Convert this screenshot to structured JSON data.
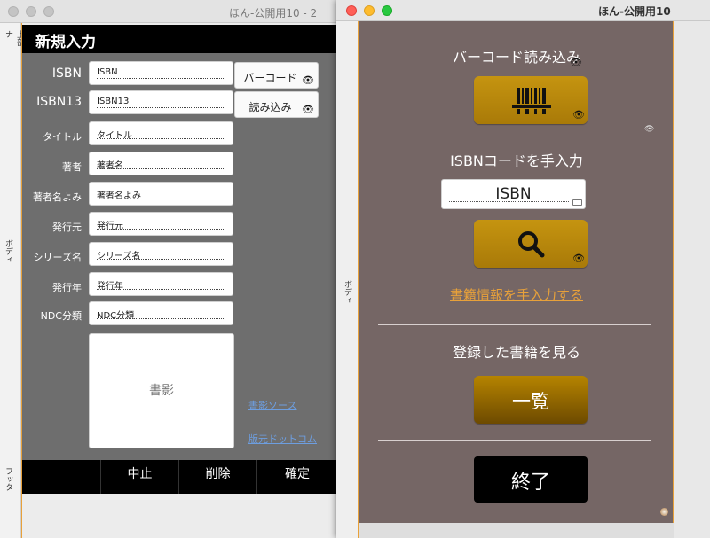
{
  "window_back": {
    "title": "ほん-公開用10 - 2",
    "parts": {
      "header": "上部ナ",
      "body": "ボディ",
      "footer": "フッタ"
    },
    "header_title": "新規入力",
    "fields": [
      {
        "label": "ISBN",
        "value": "ISBN"
      },
      {
        "label": "ISBN13",
        "value": "ISBN13"
      },
      {
        "label": "タイトル",
        "value": "タイトル"
      },
      {
        "label": "著者",
        "value": "著者名"
      },
      {
        "label": "著者名よみ",
        "value": "著者名よみ"
      },
      {
        "label": "発行元",
        "value": "発行元"
      },
      {
        "label": "シリーズ名",
        "value": "シリーズ名"
      },
      {
        "label": "発行年",
        "value": "発行年"
      },
      {
        "label": "NDC分類",
        "value": "NDC分類"
      }
    ],
    "buttons": {
      "barcode": "バーコード",
      "load": "読み込み"
    },
    "cover_label": "書影",
    "links": {
      "cover_source": "書影ソース",
      "hanmoto": "版元ドットコム"
    },
    "footer": {
      "cancel": "中止",
      "delete": "削除",
      "confirm": "確定"
    }
  },
  "window_front": {
    "title": "ほん-公開用10",
    "side_label": "ボディ",
    "barcode_section": {
      "title": "バーコード読み込み",
      "button_icon": "barcode-icon"
    },
    "isbn_section": {
      "title": "ISBNコードを手入力",
      "input_value": "ISBN",
      "search_icon": "magnifier-icon"
    },
    "manual_link": "書籍情報を手入力する",
    "list_section": {
      "title": "登録した書籍を見る",
      "button_label": "一覧"
    },
    "exit_label": "終了"
  },
  "colors": {
    "accent_gold": "#b98b0c",
    "body_brown": "#756665",
    "link_orange": "#e8a13a",
    "back_body_gray": "#6e6e6e"
  }
}
